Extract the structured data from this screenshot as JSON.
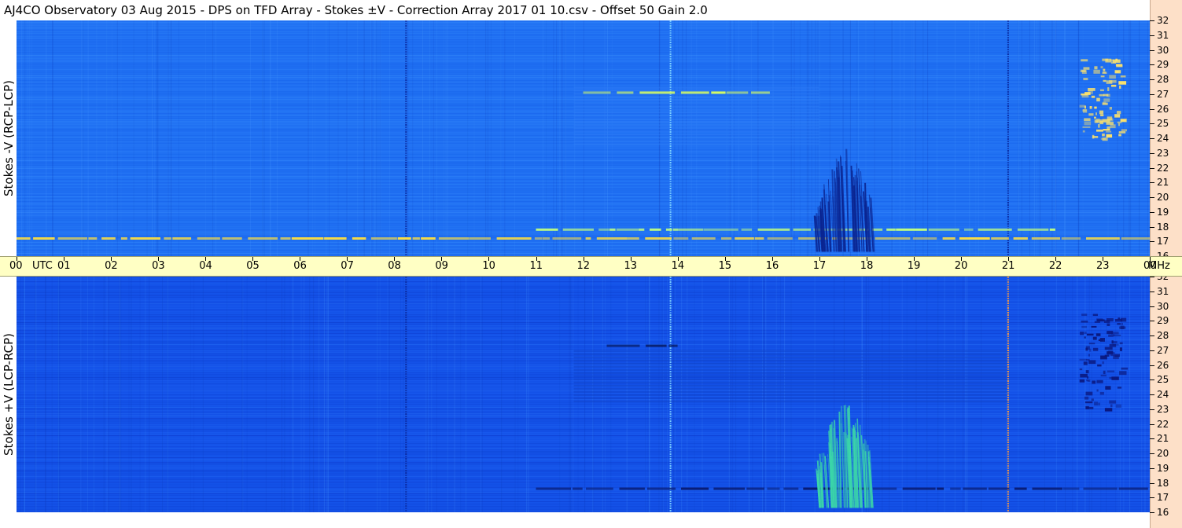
{
  "title": "AJ4CO Observatory  03 Aug 2015  -  DPS on TFD Array  -  Stokes ±V  -  Correction Array 2017 01 10.csv  -  Offset 50  Gain 2.0",
  "panels": {
    "top_label": "Stokes -V (RCP-LCP)",
    "bottom_label": "Stokes +V (LCP-RCP)"
  },
  "time_axis": {
    "labels": [
      "00",
      "UTC",
      "01",
      "02",
      "03",
      "04",
      "05",
      "06",
      "07",
      "08",
      "09",
      "10",
      "11",
      "12",
      "13",
      "14",
      "15",
      "16",
      "17",
      "18",
      "19",
      "20",
      "21",
      "22",
      "23",
      "00",
      "MHz"
    ]
  },
  "freq_axis": {
    "labels": [
      "32",
      "31",
      "30",
      "29",
      "28",
      "27",
      "26",
      "25",
      "24",
      "23",
      "22",
      "21",
      "20",
      "19",
      "18",
      "17",
      "16"
    ]
  },
  "colors": {
    "background_top": "#1f6ff2",
    "background_bottom": "#1452e8",
    "time_axis_bg": "#ffffc4",
    "freq_axis_bg": "#fde0c8"
  },
  "chart_data": {
    "type": "heatmap",
    "title": "AJ4CO Observatory  03 Aug 2015  -  DPS on TFD Array  -  Stokes ±V  -  Correction Array 2017 01 10.csv  -  Offset 50  Gain 2.0",
    "xlabel": "UTC",
    "ylabel": "MHz",
    "x_range": [
      "00 UTC",
      "00 UTC"
    ],
    "y_range": [
      16,
      32
    ],
    "panels": [
      {
        "name": "Stokes -V (RCP-LCP)",
        "features": [
          {
            "kind": "vertical_line",
            "time_utc": 8.25,
            "color": "#0a2aa0"
          },
          {
            "kind": "vertical_line",
            "time_utc": 13.85,
            "color": "#7fd4ff"
          },
          {
            "kind": "vertical_line",
            "time_utc": 21.0,
            "color": "#0a2aa0"
          },
          {
            "kind": "band",
            "time_start": 0.0,
            "time_end": 24.0,
            "freq_mhz": 17.2,
            "color": "#ffdf40"
          },
          {
            "kind": "band",
            "time_start": 11.0,
            "time_end": 22.0,
            "freq_mhz": 17.8,
            "color": "#c0ff80"
          },
          {
            "kind": "band",
            "time_start": 12.0,
            "time_end": 16.0,
            "freq_mhz": 27.1,
            "color": "#d8ff60"
          },
          {
            "kind": "burst",
            "time_start": 16.9,
            "time_end": 18.1,
            "freq_low": 16.3,
            "freq_high": 23.4,
            "color": "#0a2490"
          },
          {
            "kind": "striated_region",
            "time_start": 11.8,
            "time_end": 17.0,
            "freq_low": 23.5,
            "freq_high": 27.5,
            "color": "#2c7af6"
          },
          {
            "kind": "cluster",
            "time_start": 22.5,
            "time_end": 23.4,
            "freq_low": 24.0,
            "freq_high": 29.5,
            "color": "#ffe36a"
          }
        ]
      },
      {
        "name": "Stokes +V (LCP-RCP)",
        "features": [
          {
            "kind": "vertical_line",
            "time_utc": 8.25,
            "color": "#0a2aa0"
          },
          {
            "kind": "vertical_line",
            "time_utc": 13.85,
            "color": "#7fd4ff"
          },
          {
            "kind": "vertical_line",
            "time_utc": 21.0,
            "color": "#ff9a40"
          },
          {
            "kind": "band",
            "time_start": 11.0,
            "time_end": 24.0,
            "freq_mhz": 17.6,
            "color": "#081a70"
          },
          {
            "kind": "band",
            "time_start": 12.5,
            "time_end": 14.0,
            "freq_mhz": 27.3,
            "color": "#040c40"
          },
          {
            "kind": "burst",
            "time_start": 16.9,
            "time_end": 18.1,
            "freq_low": 16.3,
            "freq_high": 23.4,
            "color": "#3cd8a8"
          },
          {
            "kind": "striated_region",
            "time_start": 11.8,
            "time_end": 21.0,
            "freq_low": 23.5,
            "freq_high": 27.0,
            "color": "#1044c8"
          },
          {
            "kind": "cluster",
            "time_start": 22.5,
            "time_end": 23.4,
            "freq_low": 23.0,
            "freq_high": 29.5,
            "color": "#0a1880"
          }
        ]
      }
    ],
    "legend": "none",
    "grid": false
  }
}
